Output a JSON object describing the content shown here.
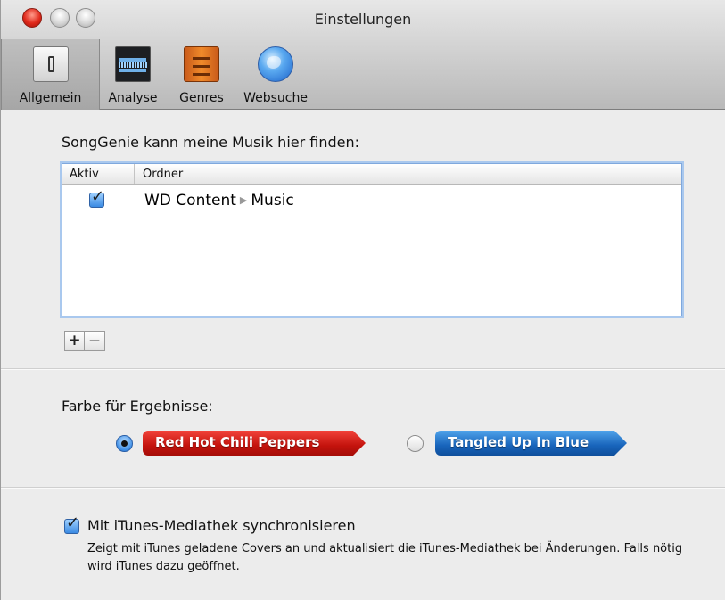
{
  "window": {
    "title": "Einstellungen"
  },
  "toolbar": {
    "items": [
      {
        "label": "Allgemein",
        "icon": "general-switch-icon",
        "selected": true
      },
      {
        "label": "Analyse",
        "icon": "waveform-icon",
        "selected": false
      },
      {
        "label": "Genres",
        "icon": "drawer-cabinet-icon",
        "selected": false
      },
      {
        "label": "Websuche",
        "icon": "globe-icon",
        "selected": false
      }
    ]
  },
  "folders": {
    "heading": "SongGenie kann meine Musik hier finden:",
    "columns": [
      "Aktiv",
      "Ordner"
    ],
    "rows": [
      {
        "aktiv": true,
        "path_parts": [
          "WD Content",
          "Music"
        ]
      }
    ],
    "add_label": "+",
    "remove_label": "−"
  },
  "colors": {
    "heading": "Farbe für Ergebnisse:",
    "options": [
      {
        "label": "Red Hot Chili Peppers",
        "selected": true,
        "color": "#c4130d"
      },
      {
        "label": "Tangled Up In Blue",
        "selected": false,
        "color": "#1864bb"
      }
    ]
  },
  "sync": {
    "label": "Mit iTunes-Mediathek synchronisieren",
    "checked": true,
    "description": "Zeigt mit iTunes geladene Covers an und aktualisiert die iTunes-Mediathek bei Änderungen. Falls nötig wird iTunes dazu geöffnet."
  }
}
